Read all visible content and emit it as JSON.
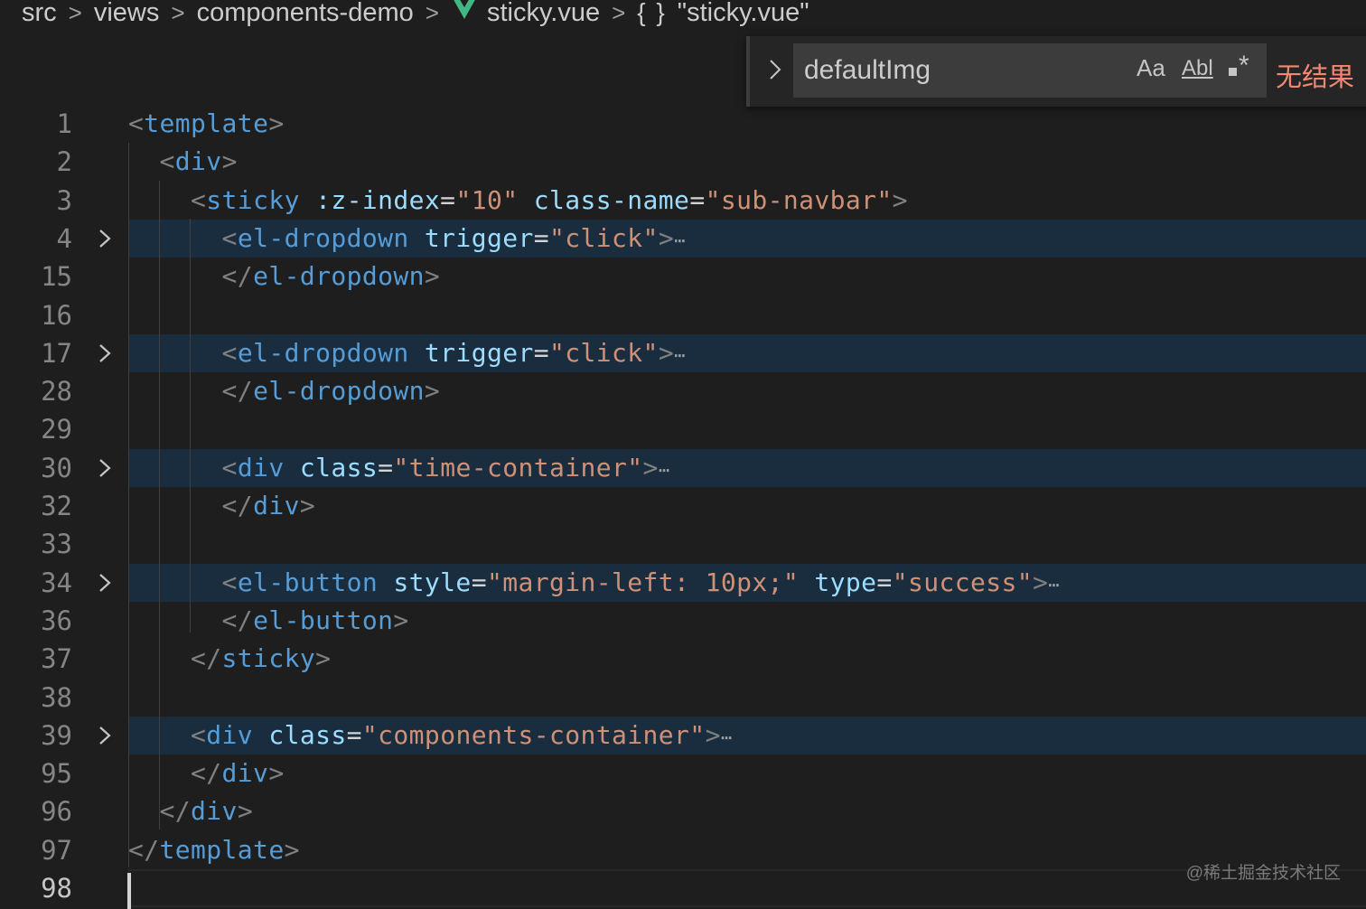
{
  "breadcrumb": {
    "items": [
      "src",
      "views",
      "components-demo",
      "sticky.vue"
    ],
    "symbol_icon": "{ }",
    "symbol": "\"sticky.vue\"",
    "file_icon": "vue-logo-icon"
  },
  "find": {
    "query": "defaultImg",
    "match_case_label": "Aa",
    "whole_word_label": "Abl",
    "regex_label": "*",
    "result": "无结果"
  },
  "colors": {
    "background": "#1e1e1e",
    "tag": "#569cd6",
    "attribute": "#9cdcfe",
    "string": "#ce9178",
    "punctuation": "#808080",
    "no_results": "#f48771",
    "folded_highlight": "#1a2d3f"
  },
  "lines": [
    {
      "num": "1",
      "folded": false,
      "tokens": [
        [
          "p",
          "<"
        ],
        [
          "t",
          "template"
        ],
        [
          "p",
          ">"
        ]
      ]
    },
    {
      "num": "2",
      "folded": false,
      "tokens": [
        [
          "x",
          "  "
        ],
        [
          "p",
          "<"
        ],
        [
          "t",
          "div"
        ],
        [
          "p",
          ">"
        ]
      ]
    },
    {
      "num": "3",
      "folded": false,
      "tokens": [
        [
          "x",
          "    "
        ],
        [
          "p",
          "<"
        ],
        [
          "t",
          "sticky"
        ],
        [
          "x",
          " "
        ],
        [
          "a",
          ":z-index"
        ],
        [
          "x",
          "="
        ],
        [
          "v",
          "\"10\""
        ],
        [
          "x",
          " "
        ],
        [
          "a",
          "class-name"
        ],
        [
          "x",
          "="
        ],
        [
          "v",
          "\"sub-navbar\""
        ],
        [
          "p",
          ">"
        ]
      ]
    },
    {
      "num": "4",
      "folded": true,
      "tokens": [
        [
          "x",
          "      "
        ],
        [
          "p",
          "<"
        ],
        [
          "t",
          "el-dropdown"
        ],
        [
          "x",
          " "
        ],
        [
          "a",
          "trigger"
        ],
        [
          "x",
          "="
        ],
        [
          "v",
          "\"click\""
        ],
        [
          "p",
          ">"
        ],
        [
          "e",
          "⋯"
        ]
      ]
    },
    {
      "num": "15",
      "folded": false,
      "tokens": [
        [
          "x",
          "      "
        ],
        [
          "p",
          "</"
        ],
        [
          "t",
          "el-dropdown"
        ],
        [
          "p",
          ">"
        ]
      ]
    },
    {
      "num": "16",
      "folded": false,
      "tokens": []
    },
    {
      "num": "17",
      "folded": true,
      "tokens": [
        [
          "x",
          "      "
        ],
        [
          "p",
          "<"
        ],
        [
          "t",
          "el-dropdown"
        ],
        [
          "x",
          " "
        ],
        [
          "a",
          "trigger"
        ],
        [
          "x",
          "="
        ],
        [
          "v",
          "\"click\""
        ],
        [
          "p",
          ">"
        ],
        [
          "e",
          "⋯"
        ]
      ]
    },
    {
      "num": "28",
      "folded": false,
      "tokens": [
        [
          "x",
          "      "
        ],
        [
          "p",
          "</"
        ],
        [
          "t",
          "el-dropdown"
        ],
        [
          "p",
          ">"
        ]
      ]
    },
    {
      "num": "29",
      "folded": false,
      "tokens": []
    },
    {
      "num": "30",
      "folded": true,
      "tokens": [
        [
          "x",
          "      "
        ],
        [
          "p",
          "<"
        ],
        [
          "t",
          "div"
        ],
        [
          "x",
          " "
        ],
        [
          "a",
          "class"
        ],
        [
          "x",
          "="
        ],
        [
          "v",
          "\"time-container\""
        ],
        [
          "p",
          ">"
        ],
        [
          "e",
          "⋯"
        ]
      ]
    },
    {
      "num": "32",
      "folded": false,
      "tokens": [
        [
          "x",
          "      "
        ],
        [
          "p",
          "</"
        ],
        [
          "t",
          "div"
        ],
        [
          "p",
          ">"
        ]
      ]
    },
    {
      "num": "33",
      "folded": false,
      "tokens": []
    },
    {
      "num": "34",
      "folded": true,
      "tokens": [
        [
          "x",
          "      "
        ],
        [
          "p",
          "<"
        ],
        [
          "t",
          "el-button"
        ],
        [
          "x",
          " "
        ],
        [
          "a",
          "style"
        ],
        [
          "x",
          "="
        ],
        [
          "v",
          "\"margin-left: 10px;\""
        ],
        [
          "x",
          " "
        ],
        [
          "a",
          "type"
        ],
        [
          "x",
          "="
        ],
        [
          "v",
          "\"success\""
        ],
        [
          "p",
          ">"
        ],
        [
          "e",
          "⋯"
        ]
      ]
    },
    {
      "num": "36",
      "folded": false,
      "tokens": [
        [
          "x",
          "      "
        ],
        [
          "p",
          "</"
        ],
        [
          "t",
          "el-button"
        ],
        [
          "p",
          ">"
        ]
      ]
    },
    {
      "num": "37",
      "folded": false,
      "tokens": [
        [
          "x",
          "    "
        ],
        [
          "p",
          "</"
        ],
        [
          "t",
          "sticky"
        ],
        [
          "p",
          ">"
        ]
      ]
    },
    {
      "num": "38",
      "folded": false,
      "tokens": []
    },
    {
      "num": "39",
      "folded": true,
      "tokens": [
        [
          "x",
          "    "
        ],
        [
          "p",
          "<"
        ],
        [
          "t",
          "div"
        ],
        [
          "x",
          " "
        ],
        [
          "a",
          "class"
        ],
        [
          "x",
          "="
        ],
        [
          "v",
          "\"components-container\""
        ],
        [
          "p",
          ">"
        ],
        [
          "e",
          "⋯"
        ]
      ]
    },
    {
      "num": "95",
      "folded": false,
      "tokens": [
        [
          "x",
          "    "
        ],
        [
          "p",
          "</"
        ],
        [
          "t",
          "div"
        ],
        [
          "p",
          ">"
        ]
      ]
    },
    {
      "num": "96",
      "folded": false,
      "tokens": [
        [
          "x",
          "  "
        ],
        [
          "p",
          "</"
        ],
        [
          "t",
          "div"
        ],
        [
          "p",
          ">"
        ]
      ]
    },
    {
      "num": "97",
      "folded": false,
      "tokens": [
        [
          "p",
          "</"
        ],
        [
          "t",
          "template"
        ],
        [
          "p",
          ">"
        ]
      ]
    },
    {
      "num": "98",
      "folded": false,
      "active": true,
      "tokens": []
    }
  ],
  "watermark": "@稀土掘金技术社区"
}
